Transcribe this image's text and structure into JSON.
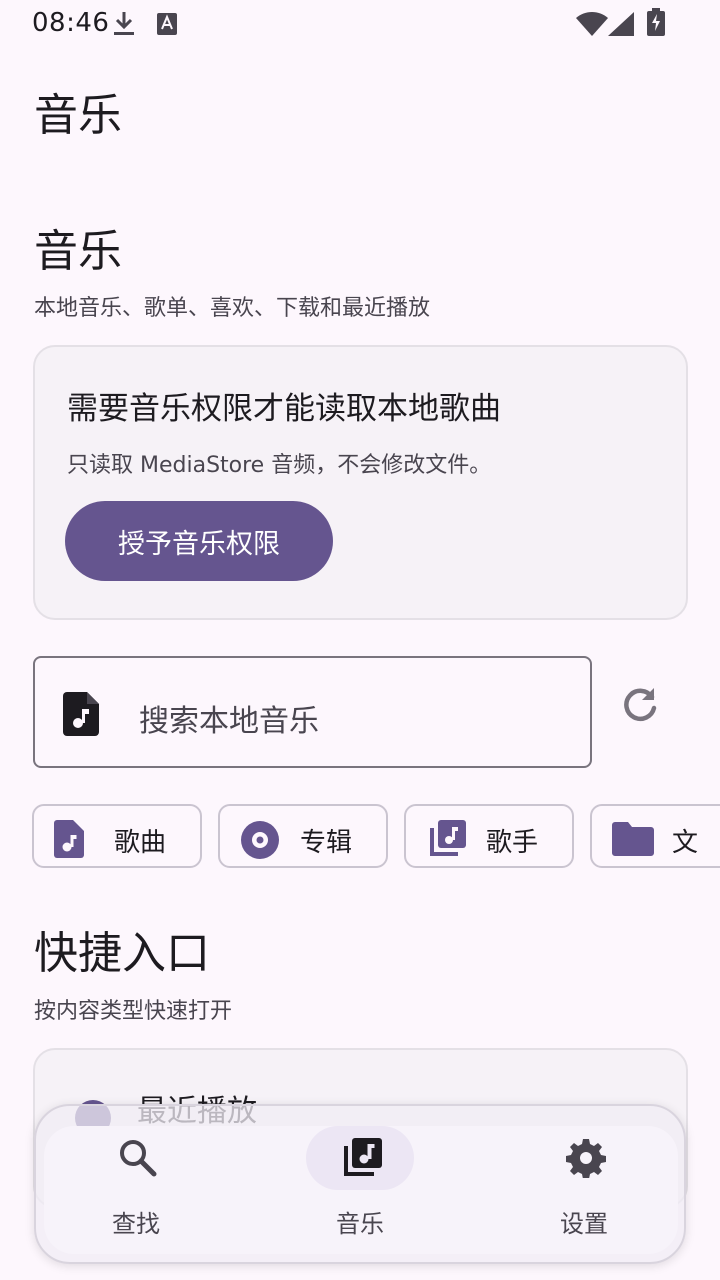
{
  "status_bar": {
    "time": "08:46"
  },
  "app_title": "音乐",
  "music_section": {
    "title": "音乐",
    "subtitle": "本地音乐、歌单、喜欢、下载和最近播放"
  },
  "permission_card": {
    "title": "需要音乐权限才能读取本地歌曲",
    "description": "只读取 MediaStore 音频，不会修改文件。",
    "button_label": "授予音乐权限"
  },
  "search": {
    "placeholder": "搜索本地音乐"
  },
  "chips": [
    {
      "label": "歌曲",
      "icon": "music-file-icon"
    },
    {
      "label": "专辑",
      "icon": "album-disc-icon"
    },
    {
      "label": "歌手",
      "icon": "library-music-icon"
    },
    {
      "label": "文",
      "icon": "folder-icon"
    }
  ],
  "quick_section": {
    "title": "快捷入口",
    "subtitle": "按内容类型快速打开"
  },
  "quick_items": [
    {
      "label": "最近播放"
    }
  ],
  "bottom_nav": {
    "items": [
      {
        "label": "查找",
        "icon": "search-icon"
      },
      {
        "label": "音乐",
        "icon": "library-music-icon"
      },
      {
        "label": "设置",
        "icon": "gear-icon"
      }
    ],
    "active_index": 1
  },
  "colors": {
    "primary": "#65558f",
    "background": "#fdf7fd",
    "card": "#f6f2f7",
    "on_surface": "#1d1b20",
    "on_surface_variant": "#49454f"
  }
}
